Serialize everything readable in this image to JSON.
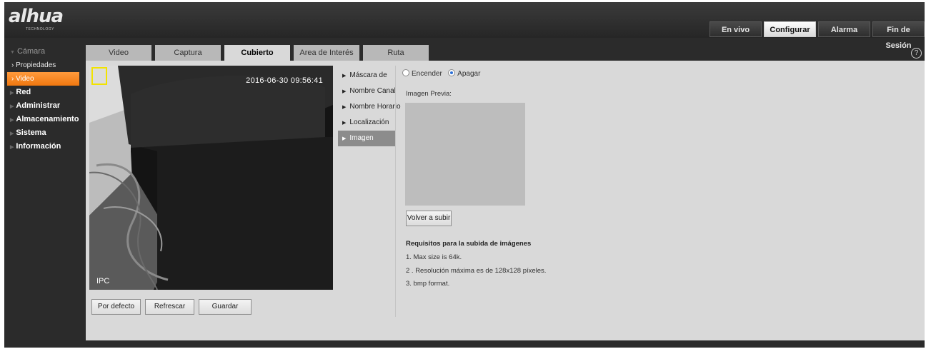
{
  "header": {
    "logo_text": "alhua",
    "logo_subtext": "TECHNOLOGY",
    "nav": [
      "En vivo",
      "Configurar",
      "Alarma",
      "Fin de Sesión"
    ],
    "active_nav": "Configurar"
  },
  "sidebar": {
    "camera": "Cámara",
    "sub_items": [
      "Propiedades",
      "Video"
    ],
    "active_sub": "Video",
    "sections": [
      "Red",
      "Administrar",
      "Almacenamiento",
      "Sistema",
      "Información"
    ]
  },
  "tabs": [
    "Video",
    "Captura",
    "Cubierto",
    "Area de Interés",
    "Ruta"
  ],
  "active_tab": "Cubierto",
  "video": {
    "timestamp": "2016-06-30 09:56:41",
    "channel_label": "IPC"
  },
  "buttons": {
    "default": "Por defecto",
    "refresh": "Refrescar",
    "save": "Guardar",
    "reupload": "Volver a subir"
  },
  "menu": [
    "Máscara de",
    "Nombre Canal",
    "Nombre Horario",
    "Localización",
    "Imagen"
  ],
  "active_menu": "Imagen",
  "settings": {
    "on_label": "Encender",
    "off_label": "Apagar",
    "selected": "Apagar",
    "preview_label": "Imagen Previa:"
  },
  "requirements": {
    "title": "Requisitos para la subida de imágenes",
    "items": [
      "1. Max size is 64k.",
      "2 . Resolución máxima es de 128x128 píxeles.",
      "3. bmp format."
    ]
  },
  "colors": {
    "accent_orange": "#f07810",
    "panel_bg": "#d9d9d9",
    "dark_bg": "#2b2b2b",
    "highlight_yellow": "#f2e300"
  }
}
